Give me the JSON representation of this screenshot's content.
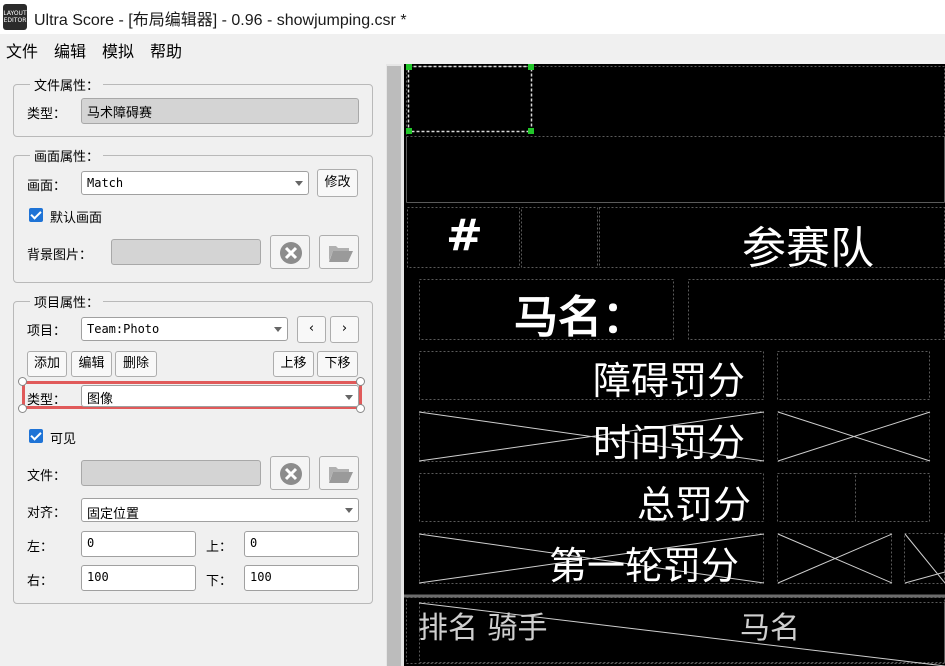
{
  "window": {
    "title": "Ultra Score - [布局编辑器] - 0.96 - showjumping.csr *",
    "app_icon_text": "LAYOUT EDITOR"
  },
  "menu": {
    "items": [
      "文件",
      "编辑",
      "模拟",
      "帮助"
    ]
  },
  "file_props": {
    "title": "文件属性：",
    "type_label": "类型：",
    "type_value": "马术障碍赛"
  },
  "screen_props": {
    "title": "画面属性：",
    "screen_label": "画面：",
    "screen_value": "Match",
    "modify_button": "修改",
    "default_checkbox_label": "默认画面",
    "default_checked": true,
    "bg_label": "背景图片："
  },
  "item_props": {
    "title": "项目属性：",
    "item_label": "项目：",
    "item_value": "Team:Photo",
    "prev_button": "‹",
    "next_button": "›",
    "add_button": "添加",
    "edit_button": "编辑",
    "delete_button": "删除",
    "up_button": "上移",
    "down_button": "下移",
    "type_label": "类型：",
    "type_value": "图像",
    "visible_label": "可见",
    "visible_checked": true,
    "file_label": "文件：",
    "align_label": "对齐：",
    "align_value": "固定位置",
    "left_label": "左：",
    "left_value": "0",
    "top_label": "上：",
    "top_value": "0",
    "right_label": "右：",
    "right_value": "100",
    "bottom_label": "下：",
    "bottom_value": "100"
  },
  "canvas": {
    "hash": "#",
    "team_header": "参赛队",
    "horse_label": "马名：",
    "obstacle_penalty": "障碍罚分",
    "time_penalty": "时间罚分",
    "total_penalty": "总罚分",
    "round1_penalty": "第一轮罚分",
    "rank_rider": "排名 骑手",
    "horse_col": "马名"
  },
  "colors": {
    "selection_handle": "#22c62a",
    "type_highlight": "#e05a5a",
    "checkbox": "#1e73d6"
  },
  "icons": {
    "clear": "clear-x-icon",
    "browse": "folder-open-icon"
  }
}
